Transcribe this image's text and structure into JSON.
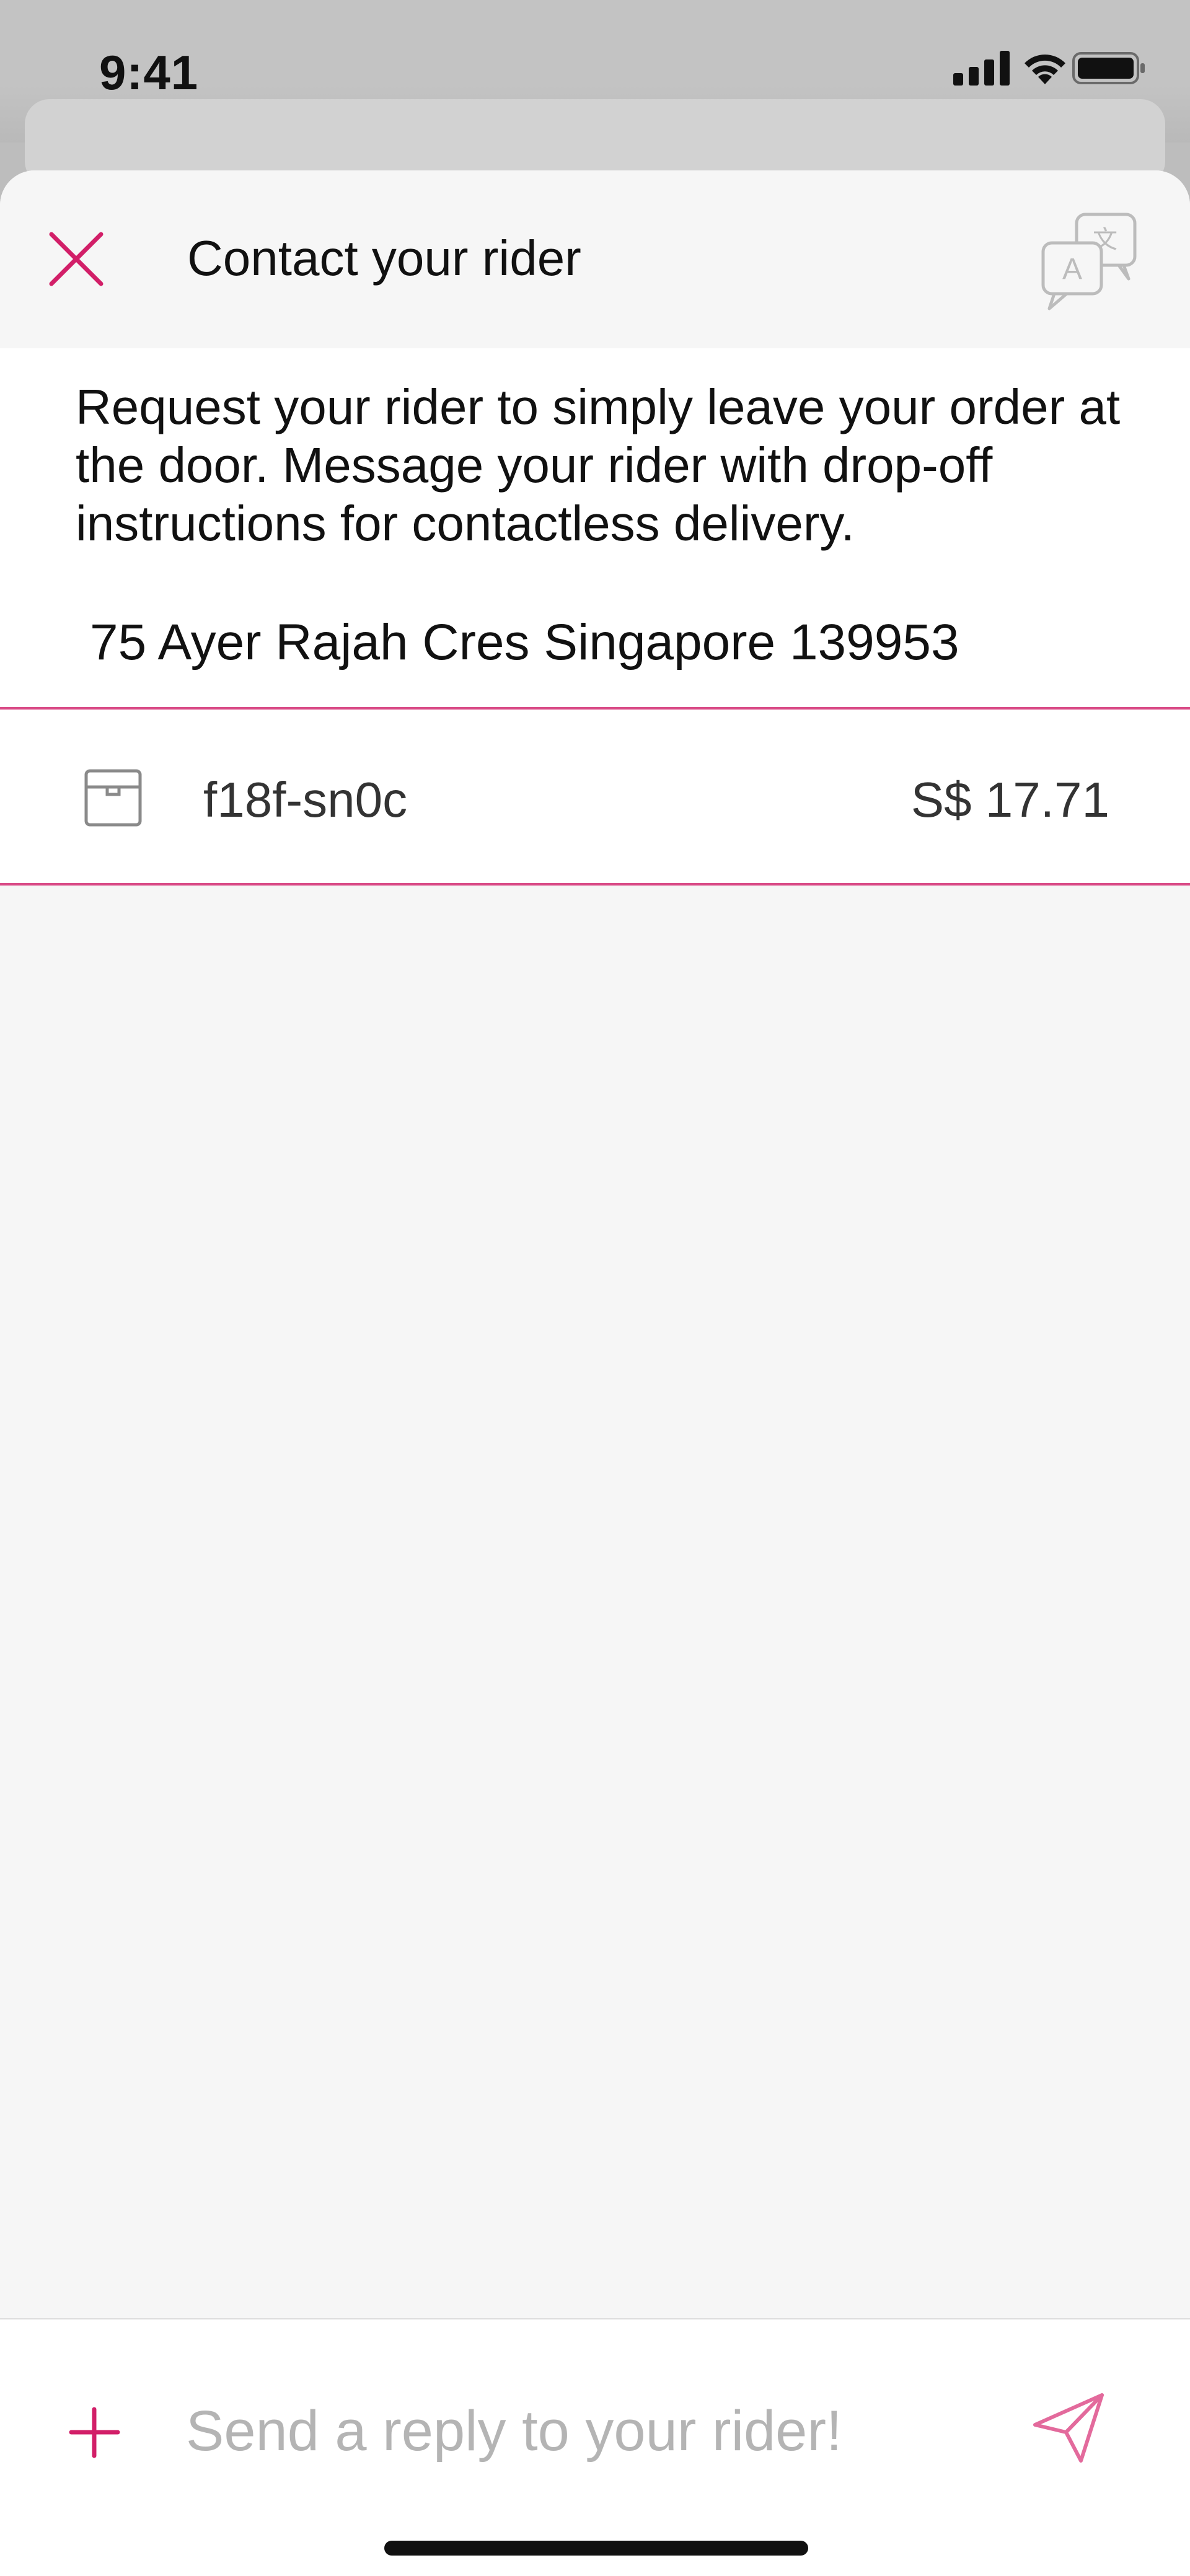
{
  "status_bar": {
    "time": "9:41",
    "icons": [
      "cellular-signal-icon",
      "wifi-icon",
      "battery-icon"
    ]
  },
  "header": {
    "title": "Contact your rider",
    "close_icon": "close-icon",
    "translate_icon": "translate-icon"
  },
  "info": {
    "instructions": "Request your rider to simply leave your order at the door. Message your rider with drop-off instructions for contactless delivery.",
    "address": "75 Ayer Rajah Cres Singapore 139953"
  },
  "order": {
    "icon": "package-icon",
    "code": "f18f-sn0c",
    "price": "S$ 17.71"
  },
  "composer": {
    "placeholder": "Send a reply to your rider!",
    "attach_icon": "plus-icon",
    "send_icon": "send-icon"
  },
  "colors": {
    "accent": "#d21f68",
    "accent_light": "#e36a9c",
    "divider": "#d94b86",
    "background": "#f6f6f6"
  }
}
